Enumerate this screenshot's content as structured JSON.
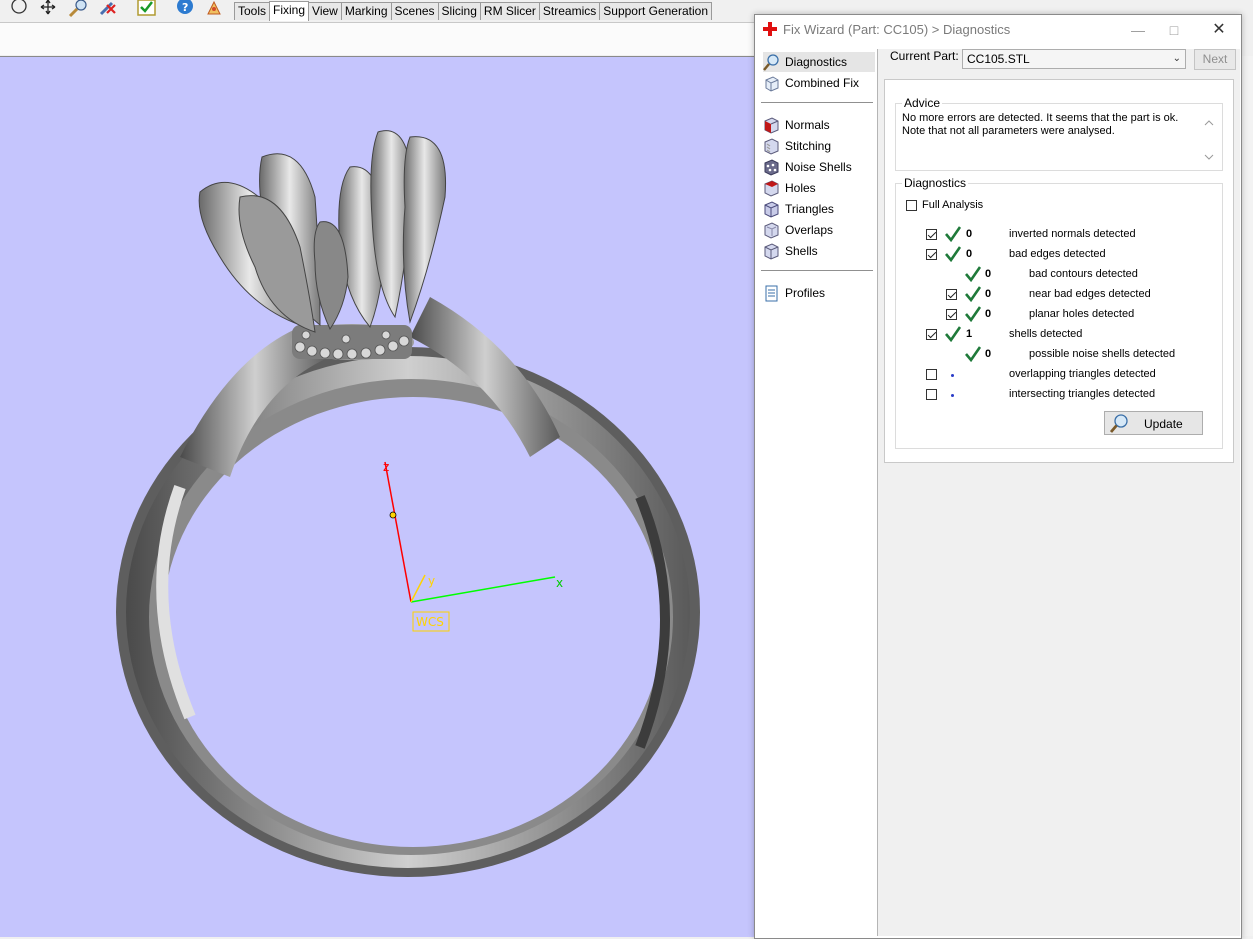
{
  "toolbar": {
    "tabs": [
      "Tools",
      "Fixing",
      "View",
      "Marking",
      "Scenes",
      "Slicing",
      "RM Slicer",
      "Streamics",
      "Support Generation"
    ],
    "active_tab": "Fixing",
    "icons": [
      "circle-select-icon",
      "move-icon",
      "zoom-icon",
      "remove-tool-icon",
      "check-icon",
      "help-icon",
      "wizard-icon"
    ]
  },
  "viewport": {
    "background": "#c5c5fd",
    "axes": {
      "x": "x",
      "y": "y",
      "z": "z",
      "wcs": "WCS"
    }
  },
  "dialog": {
    "title": "Fix Wizard (Part: CC105) > Diagnostics",
    "sidebar": {
      "group1": [
        {
          "label": "Diagnostics",
          "icon": "magnifier-icon",
          "active": true
        },
        {
          "label": "Combined Fix",
          "icon": "cube-icon"
        }
      ],
      "group2": [
        {
          "label": "Normals",
          "icon": "normals-cube-icon"
        },
        {
          "label": "Stitching",
          "icon": "stitching-cube-icon"
        },
        {
          "label": "Noise Shells",
          "icon": "noise-shells-icon"
        },
        {
          "label": "Holes",
          "icon": "holes-cube-icon"
        },
        {
          "label": "Triangles",
          "icon": "triangles-cube-icon"
        },
        {
          "label": "Overlaps",
          "icon": "overlaps-cube-icon"
        },
        {
          "label": "Shells",
          "icon": "shells-cube-icon"
        }
      ],
      "group3": [
        {
          "label": "Profiles",
          "icon": "document-icon"
        }
      ]
    },
    "current_part_label": "Current Part:",
    "current_part_value": "CC105.STL",
    "next_label": "Next",
    "advice": {
      "title": "Advice",
      "line1": "No more errors are detected. It seems that the part is ok.",
      "line2": "Note that not all parameters were analysed."
    },
    "diagnostics": {
      "title": "Diagnostics",
      "full_analysis_label": "Full Analysis",
      "full_analysis_checked": false,
      "rows": [
        {
          "checkbox": true,
          "checked": true,
          "status": "ok",
          "count": "0",
          "label": "inverted normals detected",
          "indent": 0
        },
        {
          "checkbox": true,
          "checked": true,
          "status": "ok",
          "count": "0",
          "label": "bad edges detected",
          "indent": 0
        },
        {
          "checkbox": false,
          "checked": false,
          "status": "ok",
          "count": "0",
          "label": "bad contours detected",
          "indent": 1
        },
        {
          "checkbox": true,
          "checked": true,
          "status": "ok",
          "count": "0",
          "label": "near bad edges detected",
          "indent": 1
        },
        {
          "checkbox": true,
          "checked": true,
          "status": "ok",
          "count": "0",
          "label": "planar holes detected",
          "indent": 1
        },
        {
          "checkbox": true,
          "checked": true,
          "status": "ok",
          "count": "1",
          "label": "shells detected",
          "indent": 0
        },
        {
          "checkbox": false,
          "checked": false,
          "status": "ok",
          "count": "0",
          "label": "possible noise shells detected",
          "indent": 1
        },
        {
          "checkbox": true,
          "checked": false,
          "status": "pending",
          "count": "",
          "label": "overlapping triangles detected",
          "indent": 0
        },
        {
          "checkbox": true,
          "checked": false,
          "status": "pending",
          "count": "",
          "label": "intersecting triangles detected",
          "indent": 0
        }
      ],
      "update_label": "Update"
    }
  }
}
